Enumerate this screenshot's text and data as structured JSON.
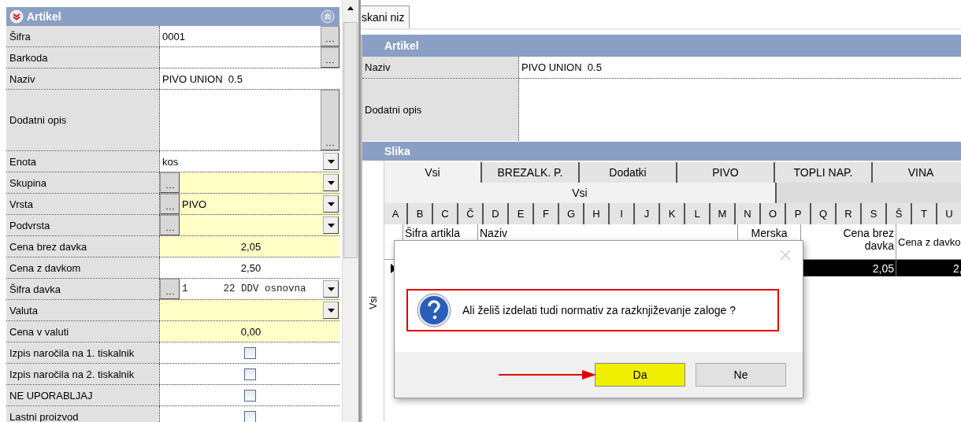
{
  "left_panel": {
    "title": "Artikel",
    "rows": [
      {
        "label": "Šifra",
        "kind": "text",
        "value": "0001",
        "browse_right": true,
        "highlighted": false
      },
      {
        "label": "Barkoda",
        "kind": "text",
        "browse_right": true,
        "highlighted": false
      },
      {
        "label": "Naziv",
        "kind": "text",
        "value": "PIVO UNION  0.5",
        "highlighted": false
      },
      {
        "label": "Dodatni opis",
        "kind": "memo",
        "browse_right": true,
        "highlighted": false
      },
      {
        "label": "Enota",
        "kind": "combo",
        "value": "kos",
        "highlighted": false
      },
      {
        "label": "Skupina",
        "kind": "combo",
        "browse_left": true,
        "highlighted": true
      },
      {
        "label": "Vrsta",
        "kind": "combo",
        "value": "PIVO",
        "browse_left": true,
        "highlighted": true
      },
      {
        "label": "Podvrsta",
        "kind": "combo",
        "browse_left": true,
        "highlighted": true
      },
      {
        "label": "Cena brez davka",
        "kind": "number",
        "value": "2,05",
        "highlighted": true
      },
      {
        "label": "Cena z davkom",
        "kind": "number",
        "value": "2,50",
        "highlighted": false
      },
      {
        "label": "Šifra davka",
        "kind": "code-combo",
        "value": "1      22 DDV osnovna",
        "browse_left": true,
        "highlighted": false
      },
      {
        "label": "Valuta",
        "kind": "combo",
        "highlighted": true
      },
      {
        "label": "Cena v valuti",
        "kind": "number",
        "value": "0,00",
        "highlighted": true
      },
      {
        "label": "Izpis naročila na 1. tiskalnik",
        "kind": "checkbox",
        "checked": false,
        "highlighted": false
      },
      {
        "label": "Izpis naročila na 2. tiskalnik",
        "kind": "checkbox",
        "checked": false,
        "highlighted": false
      },
      {
        "label": "NE UPORABLJAJ",
        "kind": "checkbox",
        "checked": false,
        "highlighted": false
      },
      {
        "label": "Lastni proizvod",
        "kind": "checkbox",
        "checked": false,
        "highlighted": false
      }
    ]
  },
  "tabs": [
    {
      "label": "skani niz",
      "selected": true
    }
  ],
  "article_section": {
    "title": "Artikel",
    "rows": [
      {
        "label": "Naziv",
        "kind": "text",
        "value": "PIVO UNION  0.5"
      },
      {
        "label": "Dodatni opis",
        "kind": "memo"
      }
    ]
  },
  "image_section": {
    "title": "Slika",
    "category_tabs": [
      {
        "label": "Vsi",
        "selected": true
      },
      {
        "label": "BREZALK. P.",
        "selected": false
      },
      {
        "label": "Dodatki",
        "selected": false
      },
      {
        "label": "PIVO",
        "selected": false
      },
      {
        "label": "TOPLI NAP.",
        "selected": false
      },
      {
        "label": "VINA",
        "selected": false
      }
    ],
    "subcategory_tabs": [
      {
        "label": "Vsi",
        "selected": true
      }
    ],
    "letter_tabs": [
      {
        "label": "A",
        "selected": false
      },
      {
        "label": "B",
        "selected": false
      },
      {
        "label": "C",
        "selected": false
      },
      {
        "label": "Č",
        "selected": false
      },
      {
        "label": "D",
        "selected": false
      },
      {
        "label": "E",
        "selected": false
      },
      {
        "label": "F",
        "selected": false
      },
      {
        "label": "G",
        "selected": false
      },
      {
        "label": "H",
        "selected": false
      },
      {
        "label": "I",
        "selected": false
      },
      {
        "label": "J",
        "selected": false
      },
      {
        "label": "K",
        "selected": false
      },
      {
        "label": "L",
        "selected": false
      },
      {
        "label": "M",
        "selected": false
      },
      {
        "label": "N",
        "selected": false
      },
      {
        "label": "O",
        "selected": false
      },
      {
        "label": "P",
        "selected": false
      },
      {
        "label": "Q",
        "selected": false
      },
      {
        "label": "R",
        "selected": false
      },
      {
        "label": "S",
        "selected": false
      },
      {
        "label": "Š",
        "selected": false
      },
      {
        "label": "T",
        "selected": false
      },
      {
        "label": "U",
        "selected": false
      }
    ],
    "side_label": "Vsi",
    "grid": {
      "columns": [
        "Šifra artikla",
        "Naziv",
        "Merska",
        "Cena brez davka",
        "Cena z davko"
      ],
      "rows": [
        {
          "current": true,
          "price_without_tax": "2,05",
          "price_with_tax": "2,"
        }
      ]
    }
  },
  "dialog": {
    "message": "Ali želiš izdelati tudi normativ za razknjiževanje zaloge ?",
    "buttons": [
      {
        "label": "Da",
        "highlighted": true
      },
      {
        "label": "Ne",
        "highlighted": false
      }
    ]
  }
}
